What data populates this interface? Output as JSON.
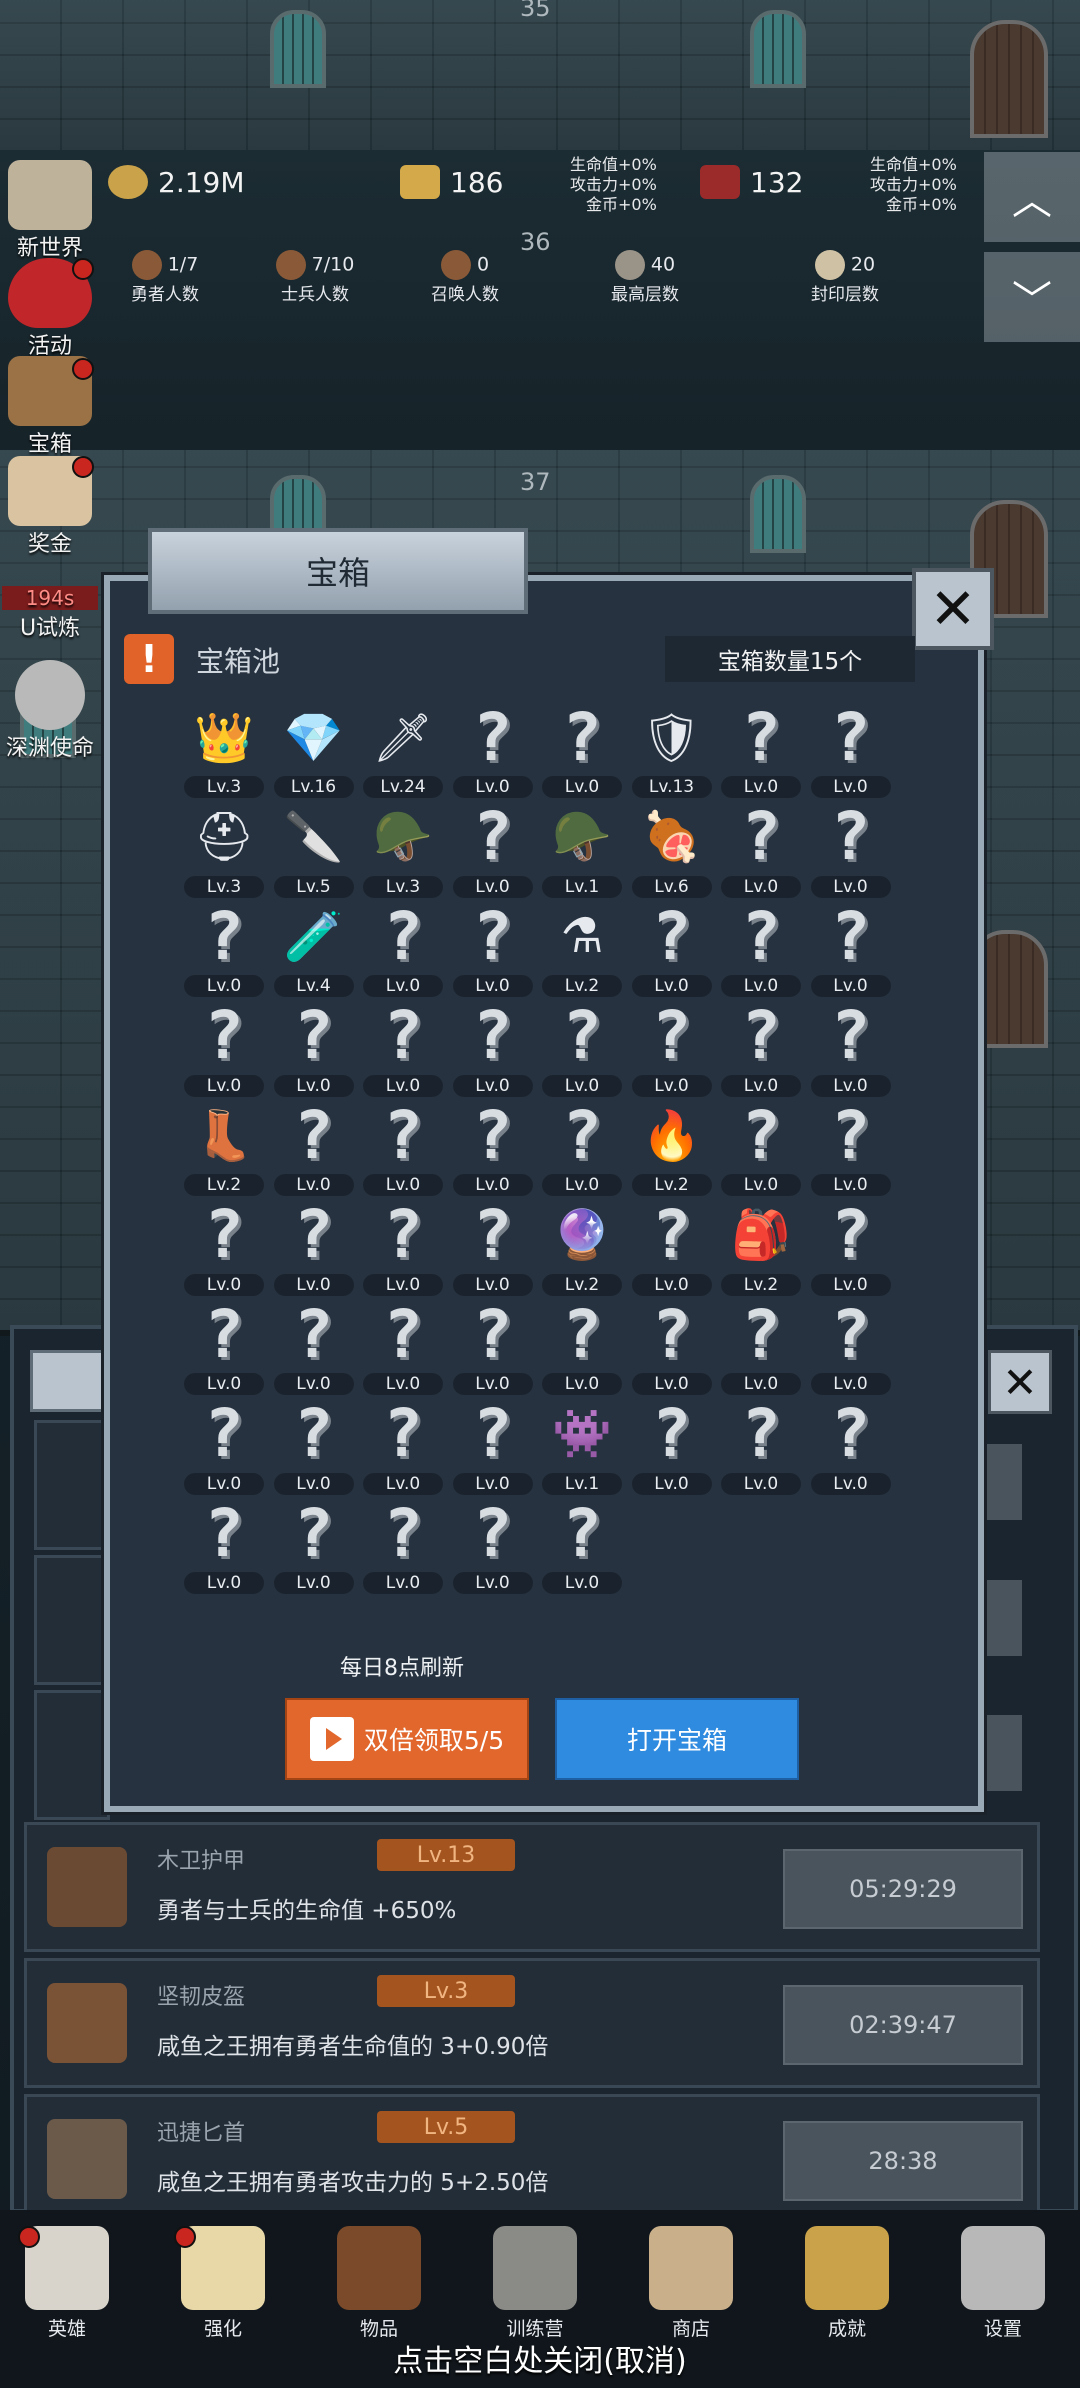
{
  "floors": [
    {
      "num": "35"
    },
    {
      "num": "36"
    },
    {
      "num": "37"
    }
  ],
  "hud": {
    "gold": "2.19M",
    "bars": "186",
    "gems": "132",
    "buff_left": [
      "生命值+0%",
      "攻击力+0%",
      "金币+0%"
    ],
    "buff_right": [
      "生命值+0%",
      "攻击力+0%",
      "金币+0%"
    ],
    "stats": [
      {
        "value": "1/7",
        "label": "勇者人数"
      },
      {
        "value": "7/10",
        "label": "士兵人数"
      },
      {
        "value": "0",
        "label": "召唤人数"
      },
      {
        "value": "40",
        "label": "最高层数"
      },
      {
        "value": "20",
        "label": "封印层数"
      }
    ]
  },
  "side_menu": [
    {
      "label": "新世界"
    },
    {
      "label": "活动"
    },
    {
      "label": "宝箱"
    },
    {
      "label": "奖金"
    },
    {
      "label": "U试炼",
      "timer": "194s"
    },
    {
      "label": "深渊使命"
    }
  ],
  "modal": {
    "title": "宝箱",
    "pool_title": "宝箱池",
    "pool_count": "宝箱数量15个",
    "refresh_text": "每日8点刷新",
    "double_button": "双倍领取5/5",
    "open_button": "打开宝箱",
    "close_symbol": "✕",
    "items": [
      {
        "icon": "crown-icon",
        "glyph": "👑",
        "lv": "Lv.3"
      },
      {
        "icon": "diamond-icon",
        "glyph": "💎",
        "lv": "Lv.16"
      },
      {
        "icon": "sword-icon",
        "glyph": "🗡",
        "lv": "Lv.24"
      },
      {
        "icon": "unknown-icon",
        "glyph": "?",
        "lv": "Lv.0"
      },
      {
        "icon": "unknown-icon",
        "glyph": "?",
        "lv": "Lv.0"
      },
      {
        "icon": "chest-armor-icon",
        "glyph": "🛡",
        "lv": "Lv.13"
      },
      {
        "icon": "unknown-icon",
        "glyph": "?",
        "lv": "Lv.0"
      },
      {
        "icon": "unknown-icon",
        "glyph": "?",
        "lv": "Lv.0"
      },
      {
        "icon": "leather-helmet-icon",
        "glyph": "⛑",
        "lv": "Lv.3"
      },
      {
        "icon": "dagger-icon",
        "glyph": "🔪",
        "lv": "Lv.5"
      },
      {
        "icon": "knight-helmet-icon",
        "glyph": "🪖",
        "lv": "Lv.3"
      },
      {
        "icon": "unknown-icon",
        "glyph": "?",
        "lv": "Lv.0"
      },
      {
        "icon": "great-helm-icon",
        "glyph": "🪖",
        "lv": "Lv.1"
      },
      {
        "icon": "meat-icon",
        "glyph": "🍖",
        "lv": "Lv.6"
      },
      {
        "icon": "unknown-icon",
        "glyph": "?",
        "lv": "Lv.0"
      },
      {
        "icon": "unknown-icon",
        "glyph": "?",
        "lv": "Lv.0"
      },
      {
        "icon": "unknown-icon",
        "glyph": "?",
        "lv": "Lv.0"
      },
      {
        "icon": "green-potion-icon",
        "glyph": "🧪",
        "lv": "Lv.4"
      },
      {
        "icon": "unknown-icon",
        "glyph": "?",
        "lv": "Lv.0"
      },
      {
        "icon": "unknown-icon",
        "glyph": "?",
        "lv": "Lv.0"
      },
      {
        "icon": "red-potion-icon",
        "glyph": "⚗",
        "lv": "Lv.2"
      },
      {
        "icon": "unknown-icon",
        "glyph": "?",
        "lv": "Lv.0"
      },
      {
        "icon": "unknown-icon",
        "glyph": "?",
        "lv": "Lv.0"
      },
      {
        "icon": "unknown-icon",
        "glyph": "?",
        "lv": "Lv.0"
      },
      {
        "icon": "unknown-icon",
        "glyph": "?",
        "lv": "Lv.0"
      },
      {
        "icon": "unknown-icon",
        "glyph": "?",
        "lv": "Lv.0"
      },
      {
        "icon": "unknown-icon",
        "glyph": "?",
        "lv": "Lv.0"
      },
      {
        "icon": "unknown-icon",
        "glyph": "?",
        "lv": "Lv.0"
      },
      {
        "icon": "unknown-icon",
        "glyph": "?",
        "lv": "Lv.0"
      },
      {
        "icon": "unknown-icon",
        "glyph": "?",
        "lv": "Lv.0"
      },
      {
        "icon": "unknown-icon",
        "glyph": "?",
        "lv": "Lv.0"
      },
      {
        "icon": "unknown-icon",
        "glyph": "?",
        "lv": "Lv.0"
      },
      {
        "icon": "boot-icon",
        "glyph": "👢",
        "lv": "Lv.2"
      },
      {
        "icon": "unknown-icon",
        "glyph": "?",
        "lv": "Lv.0"
      },
      {
        "icon": "unknown-icon",
        "glyph": "?",
        "lv": "Lv.0"
      },
      {
        "icon": "unknown-icon",
        "glyph": "?",
        "lv": "Lv.0"
      },
      {
        "icon": "unknown-icon",
        "glyph": "?",
        "lv": "Lv.0"
      },
      {
        "icon": "torch-icon",
        "glyph": "🔥",
        "lv": "Lv.2"
      },
      {
        "icon": "unknown-icon",
        "glyph": "?",
        "lv": "Lv.0"
      },
      {
        "icon": "unknown-icon",
        "glyph": "?",
        "lv": "Lv.0"
      },
      {
        "icon": "unknown-icon",
        "glyph": "?",
        "lv": "Lv.0"
      },
      {
        "icon": "unknown-icon",
        "glyph": "?",
        "lv": "Lv.0"
      },
      {
        "icon": "unknown-icon",
        "glyph": "?",
        "lv": "Lv.0"
      },
      {
        "icon": "unknown-icon",
        "glyph": "?",
        "lv": "Lv.0"
      },
      {
        "icon": "staff-icon",
        "glyph": "🔮",
        "lv": "Lv.2"
      },
      {
        "icon": "unknown-icon",
        "glyph": "?",
        "lv": "Lv.0"
      },
      {
        "icon": "backpack-icon",
        "glyph": "🎒",
        "lv": "Lv.2"
      },
      {
        "icon": "unknown-icon",
        "glyph": "?",
        "lv": "Lv.0"
      },
      {
        "icon": "unknown-icon",
        "glyph": "?",
        "lv": "Lv.0"
      },
      {
        "icon": "unknown-icon",
        "glyph": "?",
        "lv": "Lv.0"
      },
      {
        "icon": "unknown-icon",
        "glyph": "?",
        "lv": "Lv.0"
      },
      {
        "icon": "unknown-icon",
        "glyph": "?",
        "lv": "Lv.0"
      },
      {
        "icon": "unknown-icon",
        "glyph": "?",
        "lv": "Lv.0"
      },
      {
        "icon": "unknown-icon",
        "glyph": "?",
        "lv": "Lv.0"
      },
      {
        "icon": "unknown-icon",
        "glyph": "?",
        "lv": "Lv.0"
      },
      {
        "icon": "unknown-icon",
        "glyph": "?",
        "lv": "Lv.0"
      },
      {
        "icon": "unknown-icon",
        "glyph": "?",
        "lv": "Lv.0"
      },
      {
        "icon": "unknown-icon",
        "glyph": "?",
        "lv": "Lv.0"
      },
      {
        "icon": "unknown-icon",
        "glyph": "?",
        "lv": "Lv.0"
      },
      {
        "icon": "unknown-icon",
        "glyph": "?",
        "lv": "Lv.0"
      },
      {
        "icon": "monster-icon",
        "glyph": "👾",
        "lv": "Lv.1"
      },
      {
        "icon": "unknown-icon",
        "glyph": "?",
        "lv": "Lv.0"
      },
      {
        "icon": "unknown-icon",
        "glyph": "?",
        "lv": "Lv.0"
      },
      {
        "icon": "unknown-icon",
        "glyph": "?",
        "lv": "Lv.0"
      },
      {
        "icon": "unknown-icon",
        "glyph": "?",
        "lv": "Lv.0"
      },
      {
        "icon": "unknown-icon",
        "glyph": "?",
        "lv": "Lv.0"
      },
      {
        "icon": "unknown-icon",
        "glyph": "?",
        "lv": "Lv.0"
      },
      {
        "icon": "unknown-icon",
        "glyph": "?",
        "lv": "Lv.0"
      },
      {
        "icon": "unknown-icon",
        "glyph": "?",
        "lv": "Lv.0"
      }
    ]
  },
  "reward_list": [
    {
      "name": "木卫护甲",
      "lv": "Lv.13",
      "desc": "勇者与士兵的生命值 +650%",
      "timer": "05:29:29"
    },
    {
      "name": "坚韧皮盔",
      "lv": "Lv.3",
      "desc": "咸鱼之王拥有勇者生命值的 3+0.90倍",
      "timer": "02:39:47"
    },
    {
      "name": "迅捷匕首",
      "lv": "Lv.5",
      "desc": "咸鱼之王拥有勇者攻击力的 5+2.50倍",
      "timer": "28:38"
    }
  ],
  "bottom_nav": [
    {
      "label": "英雄",
      "dot": true
    },
    {
      "label": "强化",
      "dot": true
    },
    {
      "label": "物品",
      "dot": false
    },
    {
      "label": "训练营",
      "dot": false
    },
    {
      "label": "商店",
      "dot": false
    },
    {
      "label": "成就",
      "dot": false
    },
    {
      "label": "设置",
      "dot": false
    }
  ],
  "close_hint": "点击空白处关闭(取消)"
}
